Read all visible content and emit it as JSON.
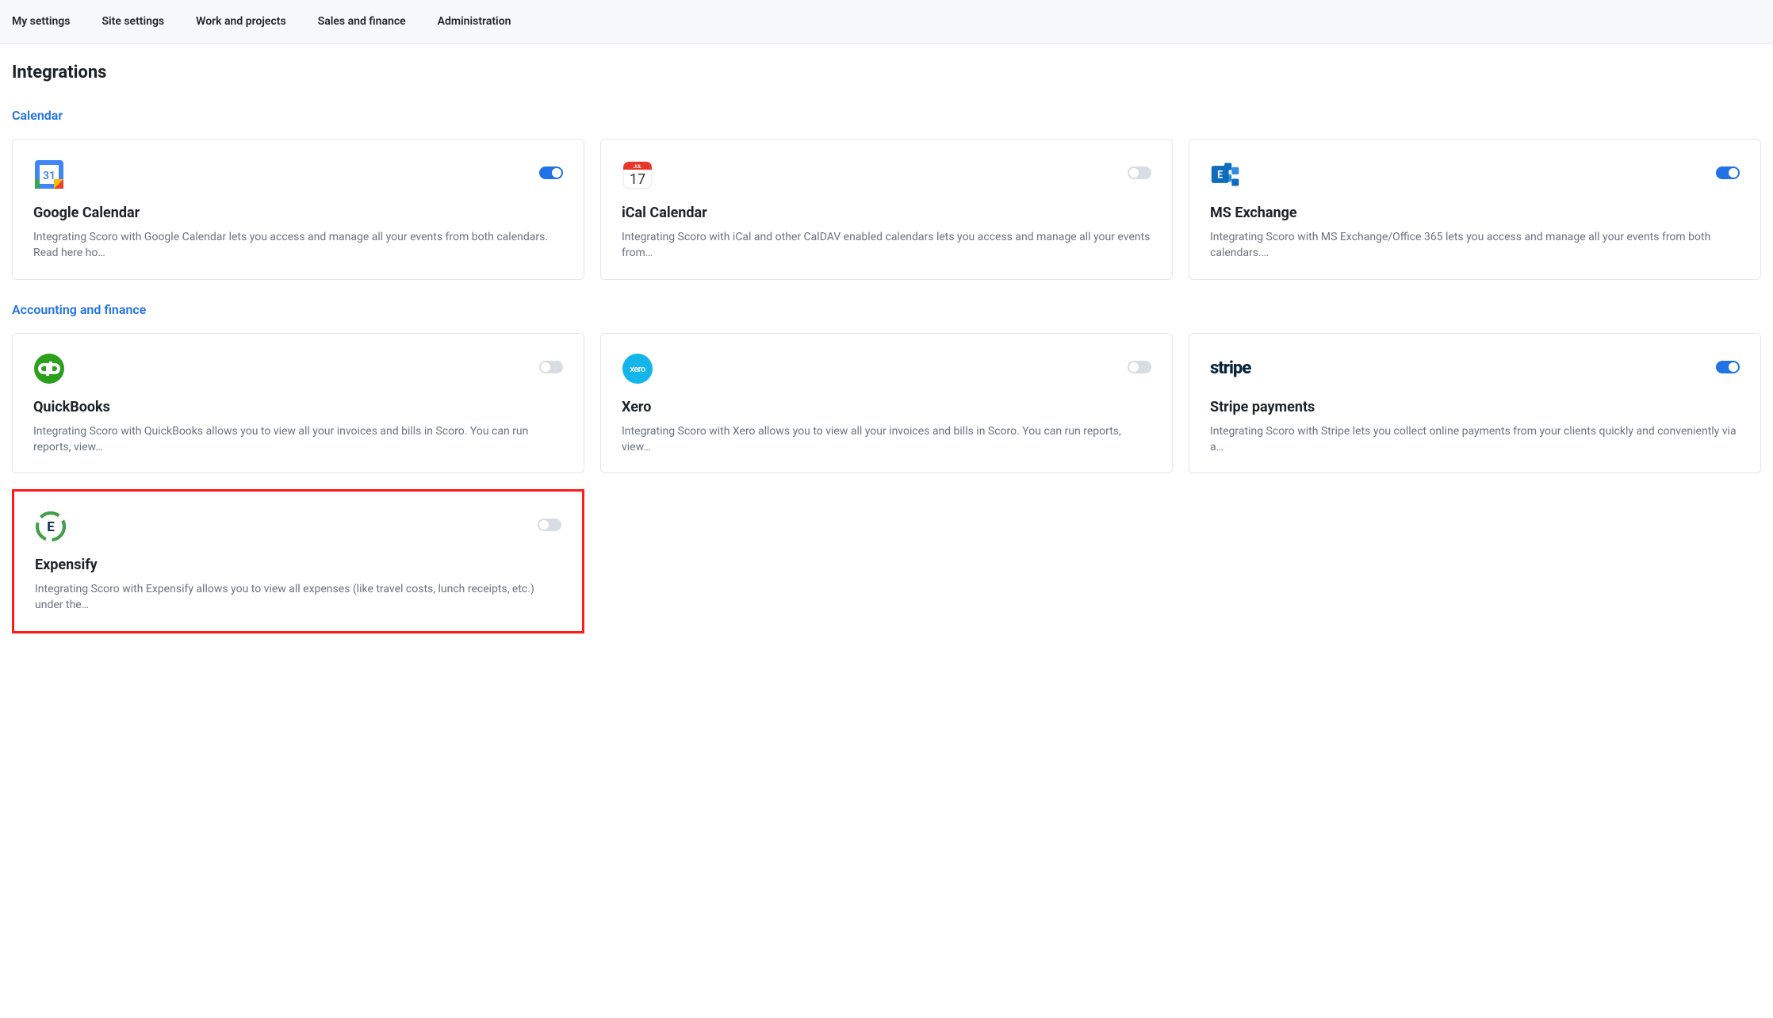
{
  "nav": {
    "items": [
      "My settings",
      "Site settings",
      "Work and projects",
      "Sales and finance",
      "Administration"
    ]
  },
  "page": {
    "title": "Integrations"
  },
  "sections": {
    "calendar": {
      "title": "Calendar",
      "items": [
        {
          "title": "Google Calendar",
          "desc": "Integrating Scoro with Google Calendar lets you access and manage all your events from both calendars. Read here ho…",
          "enabled": true
        },
        {
          "title": "iCal Calendar",
          "desc": "Integrating Scoro with iCal and other CalDAV enabled calendars lets you access and manage all your events from…",
          "enabled": false
        },
        {
          "title": "MS Exchange",
          "desc": "Integrating Scoro with MS Exchange/Office 365 lets you access and manage all your events from both calendars.…",
          "enabled": true
        }
      ]
    },
    "accounting": {
      "title": "Accounting and finance",
      "items": [
        {
          "title": "QuickBooks",
          "desc": "Integrating Scoro with QuickBooks allows you to view all your invoices and bills in Scoro. You can run reports, view…",
          "enabled": false
        },
        {
          "title": "Xero",
          "desc": "Integrating Scoro with Xero allows you to view all your invoices and bills in Scoro. You can run reports, view…",
          "enabled": false
        },
        {
          "title": "Stripe payments",
          "desc": "Integrating Scoro with Stripe lets you collect online payments from your clients quickly and conveniently via a…",
          "enabled": true
        },
        {
          "title": "Expensify",
          "desc": "Integrating Scoro with Expensify allows you to view all expenses (like travel costs, lunch receipts, etc.) under the…",
          "enabled": false
        }
      ]
    }
  }
}
